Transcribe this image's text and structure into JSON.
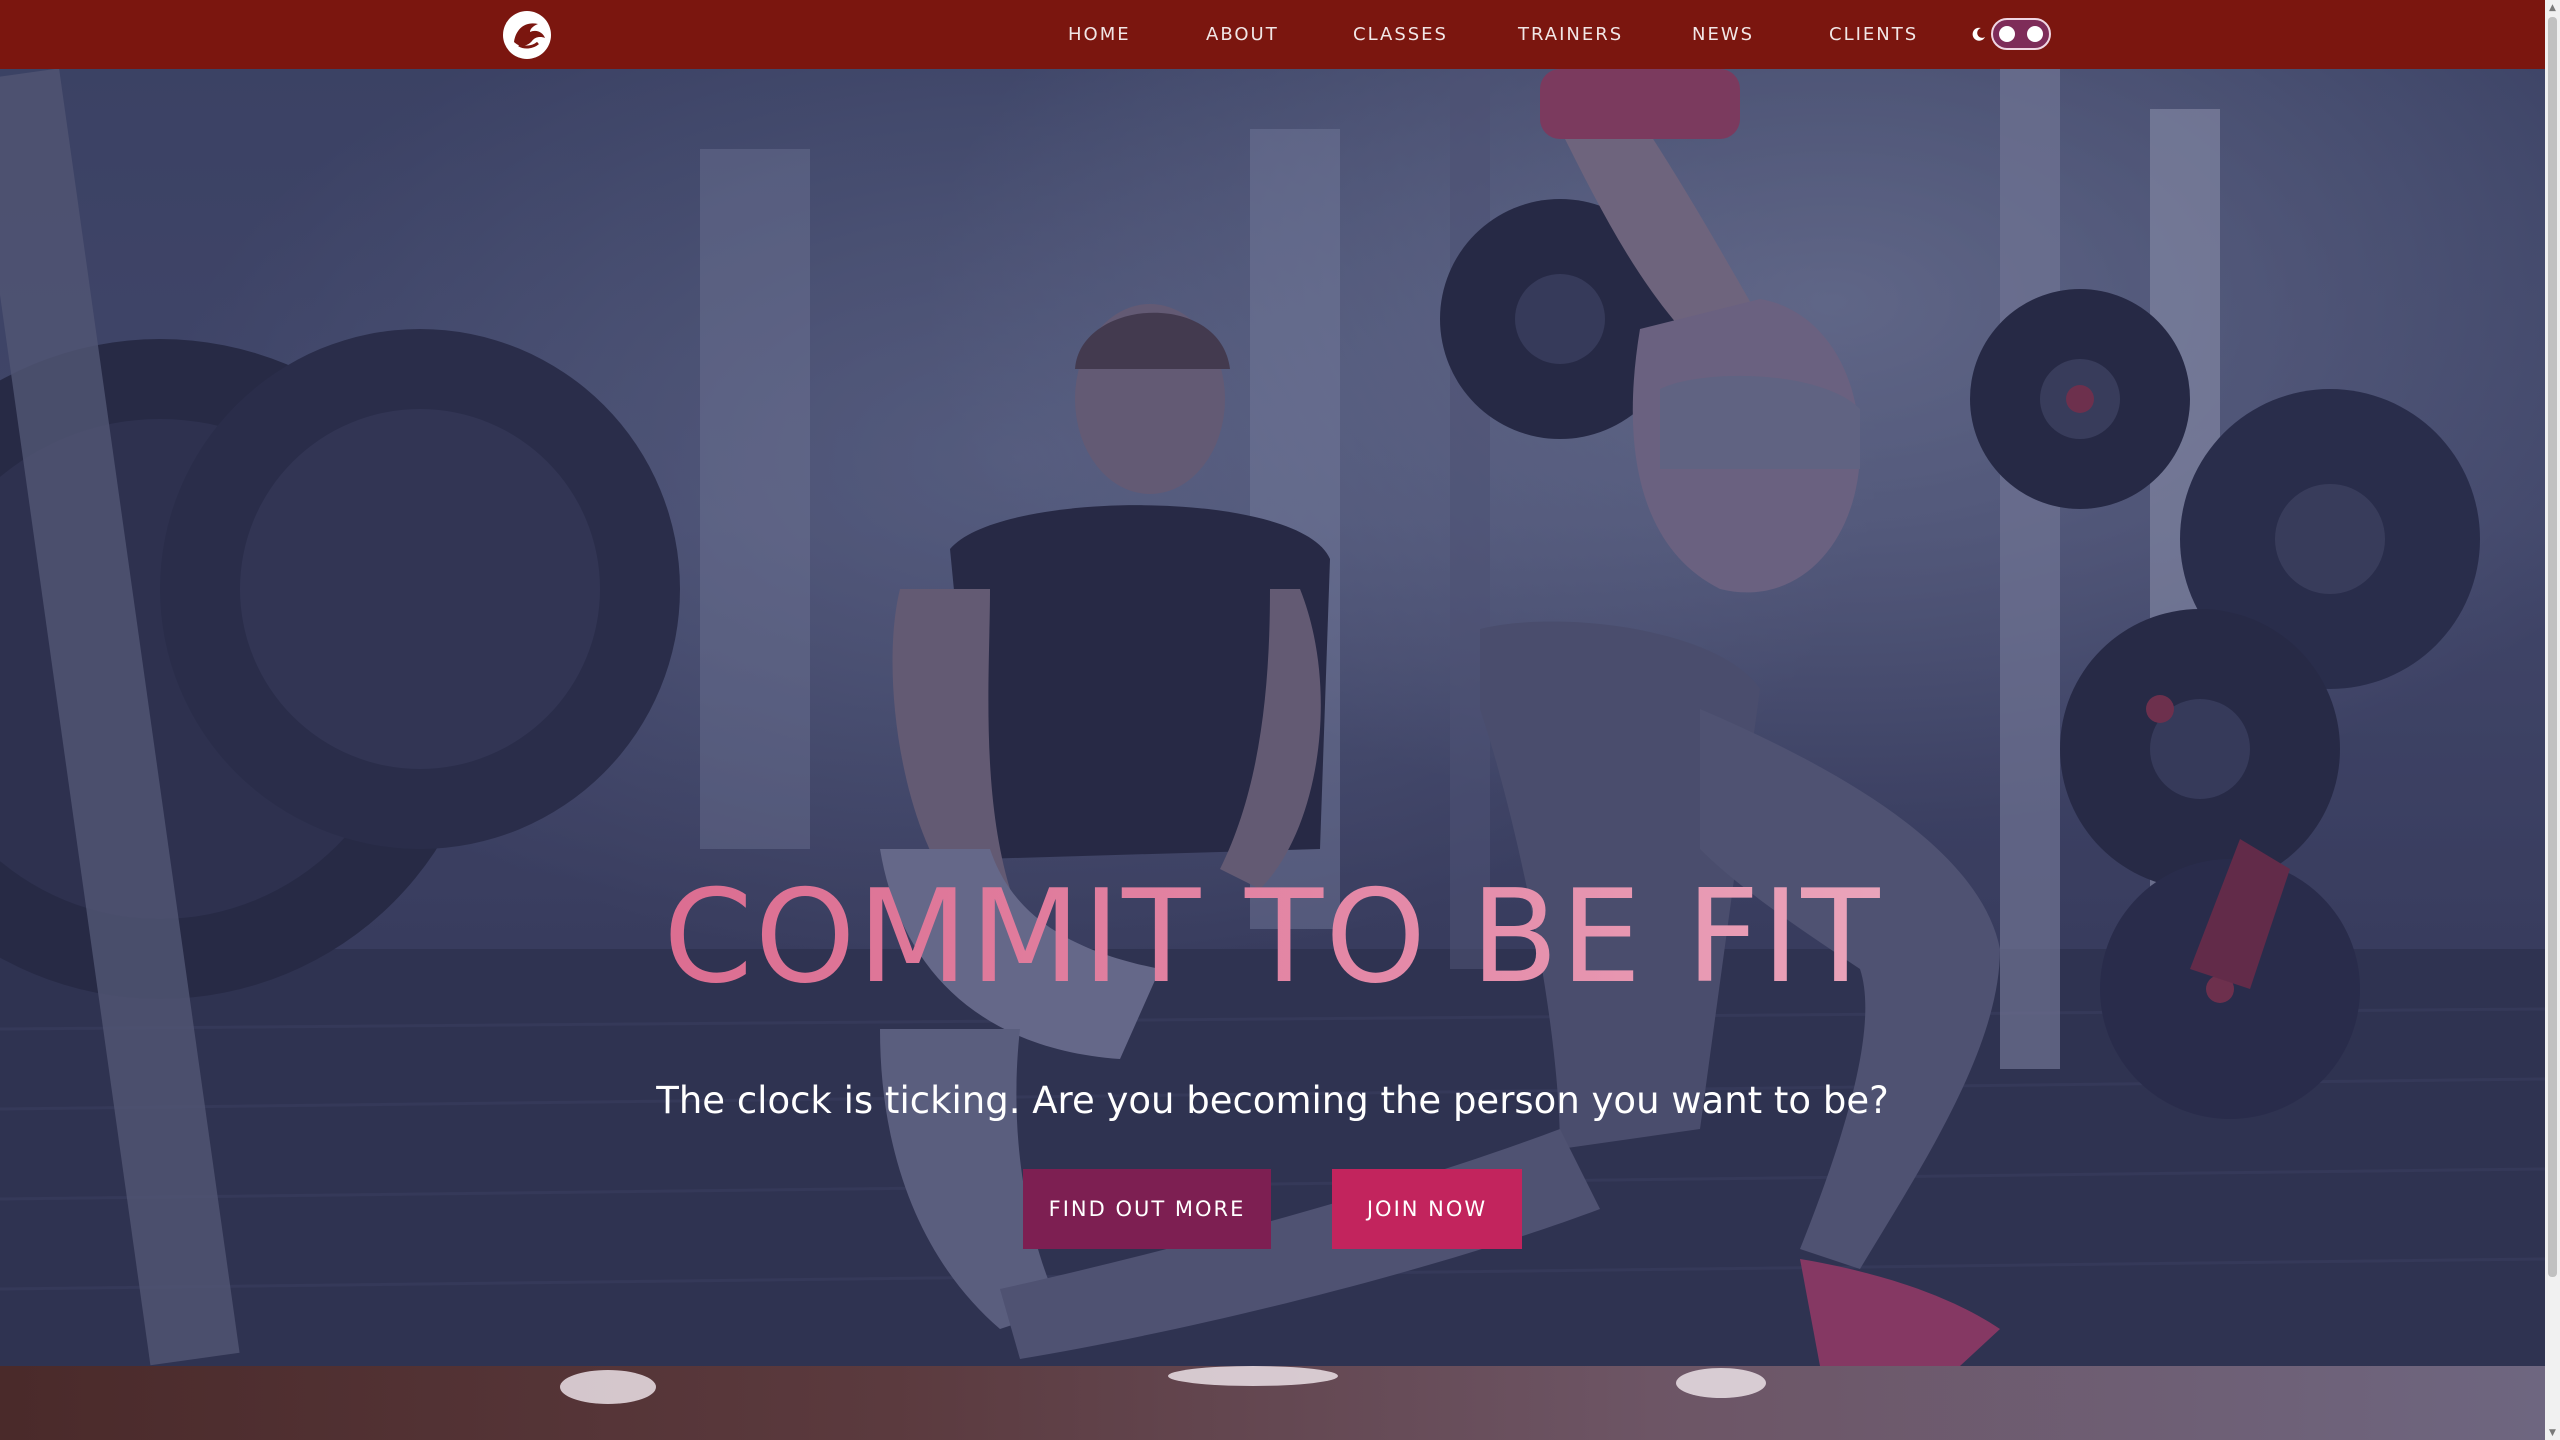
{
  "nav": {
    "logo_icon": "fist-logo-icon",
    "items": [
      {
        "label": "HOME"
      },
      {
        "label": "ABOUT"
      },
      {
        "label": "CLASSES"
      },
      {
        "label": "TRAINERS"
      },
      {
        "label": "NEWS"
      },
      {
        "label": "CLIENTS"
      }
    ],
    "theme_toggle_icon": "moon-icon"
  },
  "hero": {
    "title": "COMMIT TO BE FIT",
    "subtitle": "The clock is ticking. Are you becoming the person you want to be?",
    "buttons": [
      {
        "label": "FIND OUT MORE"
      },
      {
        "label": "JOIN NOW"
      }
    ]
  },
  "colors": {
    "navbar": "#7b160f",
    "accent_dark": "#7d1f52",
    "accent": "#c2245d",
    "title_gradient_start": "#d4547c",
    "title_gradient_end": "#f3c7d3"
  }
}
